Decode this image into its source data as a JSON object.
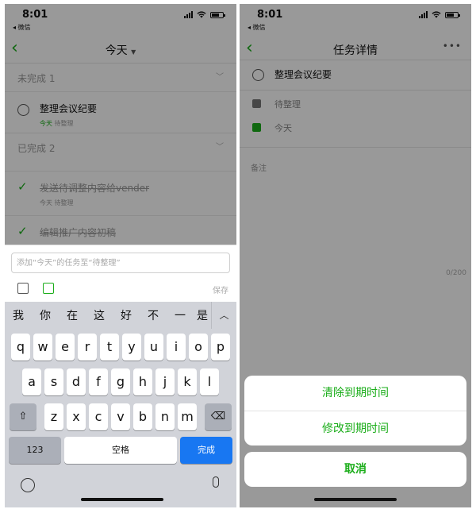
{
  "status": {
    "time": "8:01",
    "carrier": "◂ 微信"
  },
  "left": {
    "title": "今天",
    "sections": [
      {
        "label": "未完成",
        "count": "1"
      },
      {
        "label": "已完成",
        "count": "2"
      }
    ],
    "pending_task": {
      "title": "整理会议纪要",
      "date": "今天",
      "list": "待整理"
    },
    "done_tasks": [
      {
        "title": "发送待调整内容给vender",
        "meta": "今天 待整理"
      },
      {
        "title": "编辑推广内容初稿",
        "meta": ""
      }
    ],
    "composer": {
      "placeholder": "添加“今天”的任务至“待整理”",
      "save_label": "保存"
    },
    "keyboard": {
      "candidates": [
        "我",
        "你",
        "在",
        "这",
        "好",
        "不",
        "一",
        "是"
      ],
      "row1": [
        "q",
        "w",
        "e",
        "r",
        "t",
        "y",
        "u",
        "i",
        "o",
        "p"
      ],
      "row2": [
        "a",
        "s",
        "d",
        "f",
        "g",
        "h",
        "j",
        "k",
        "l"
      ],
      "row3": [
        "z",
        "x",
        "c",
        "v",
        "b",
        "n",
        "m"
      ],
      "shift": "⇧",
      "backspace": "⌫",
      "collapse": "︿",
      "num_key": "123",
      "space_key": "空格",
      "done_key": "完成"
    }
  },
  "right": {
    "title": "任务详情",
    "more": "•••",
    "task_title": "整理会议纪要",
    "list_name": "待整理",
    "date": "今天",
    "notes_label": "备注",
    "counter": "0/200",
    "sheet": {
      "options": [
        "清除到期时间",
        "修改到期时间"
      ],
      "cancel": "取消"
    }
  },
  "colors": {
    "accent": "#1aad19",
    "keyboard_done": "#1877f2",
    "overlay": "rgba(0,0,0,0.4)"
  },
  "icons": [
    "back-chevron-icon",
    "dropdown-caret-icon",
    "chevron-down-icon",
    "checkmark-icon",
    "move-list-icon",
    "calendar-icon",
    "globe-icon",
    "microphone-icon",
    "more-icon",
    "inbox-icon"
  ]
}
